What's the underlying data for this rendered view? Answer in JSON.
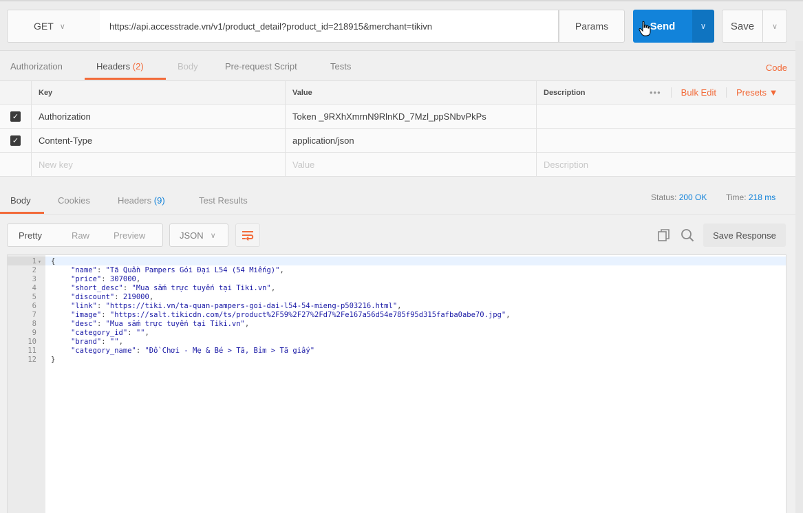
{
  "request": {
    "method": "GET",
    "url": "https://api.accesstrade.vn/v1/product_detail?product_id=218915&merchant=tikivn",
    "params_label": "Params",
    "send_label": "Send",
    "save_label": "Save"
  },
  "request_tabs": {
    "authorization": "Authorization",
    "headers": "Headers",
    "headers_count": "(2)",
    "body": "Body",
    "prerequest": "Pre-request Script",
    "tests": "Tests",
    "code": "Code"
  },
  "headers_table": {
    "col_key": "Key",
    "col_value": "Value",
    "col_description": "Description",
    "more": "•••",
    "bulk_edit": "Bulk Edit",
    "presets": "Presets ▼",
    "rows": [
      {
        "key": "Authorization",
        "value": "Token _9RXhXmrnN9RlnKD_7Mzl_ppSNbvPkPs"
      },
      {
        "key": "Content-Type",
        "value": "application/json"
      }
    ],
    "new_key_placeholder": "New key",
    "new_value_placeholder": "Value",
    "new_desc_placeholder": "Description"
  },
  "response_tabs": {
    "body": "Body",
    "cookies": "Cookies",
    "headers": "Headers",
    "headers_count": "(9)",
    "test_results": "Test Results",
    "status_label": "Status:",
    "status_value": "200 OK",
    "time_label": "Time:",
    "time_value": "218 ms"
  },
  "response_toolbar": {
    "pretty": "Pretty",
    "raw": "Raw",
    "preview": "Preview",
    "format": "JSON",
    "save_response": "Save Response"
  },
  "code_lines": [
    {
      "n": "1",
      "fold": true,
      "text": "{"
    },
    {
      "n": "2",
      "key": "\"name\"",
      "val": "\"Tã Quần Pampers Gói Đại L54 (54 Miếng)\"",
      "end": ","
    },
    {
      "n": "3",
      "key": "\"price\"",
      "val": "307000",
      "end": ","
    },
    {
      "n": "4",
      "key": "\"short_desc\"",
      "val": "\"Mua sắm trực tuyến tại Tiki.vn\"",
      "end": ","
    },
    {
      "n": "5",
      "key": "\"discount\"",
      "val": "219000",
      "end": ","
    },
    {
      "n": "6",
      "key": "\"link\"",
      "val": "\"https://tiki.vn/ta-quan-pampers-goi-dai-l54-54-mieng-p503216.html\"",
      "end": ","
    },
    {
      "n": "7",
      "key": "\"image\"",
      "val": "\"https://salt.tikicdn.com/ts/product%2F59%2F27%2Fd7%2Fe167a56d54e785f95d315fafba0abe70.jpg\"",
      "end": ","
    },
    {
      "n": "8",
      "key": "\"desc\"",
      "val": "\"Mua sắm trực tuyến tại Tiki.vn\"",
      "end": ","
    },
    {
      "n": "9",
      "key": "\"category_id\"",
      "val": "\"\"",
      "end": ","
    },
    {
      "n": "10",
      "key": "\"brand\"",
      "val": "\"\"",
      "end": ","
    },
    {
      "n": "11",
      "key": "\"category_name\"",
      "val": "\"Đồ Chơi - Mẹ & Bé > Tã, Bỉm > Tã giấy\"",
      "end": ""
    },
    {
      "n": "12",
      "text": "}"
    }
  ]
}
